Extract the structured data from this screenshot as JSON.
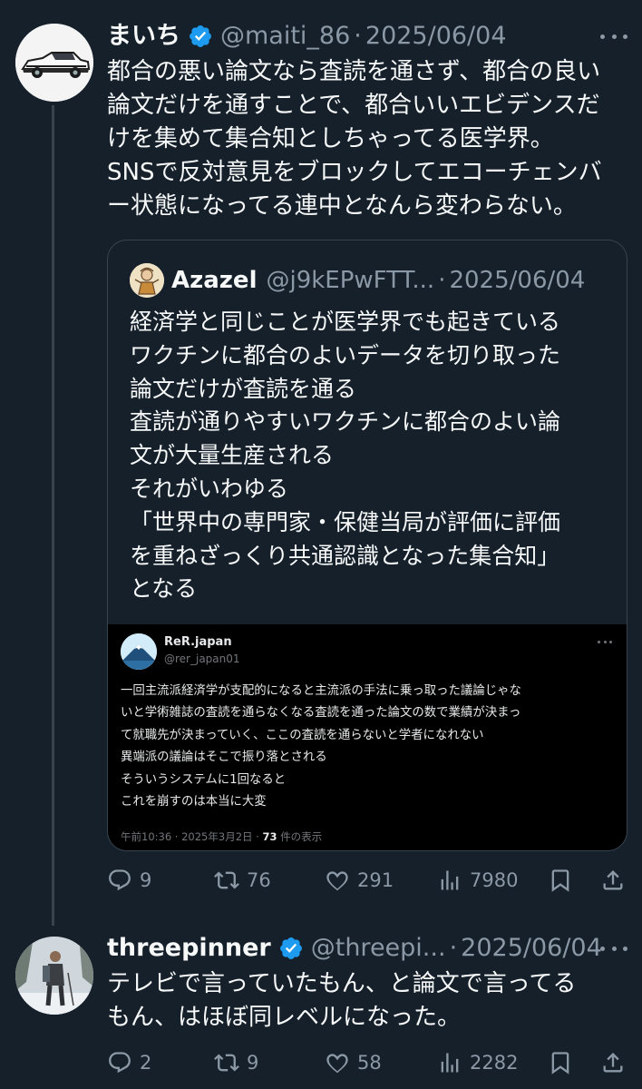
{
  "colors": {
    "background": "#15202b",
    "text": "#f7f9f9",
    "muted": "#8b98a5",
    "verified": "#1d9bf0",
    "border": "#38444d"
  },
  "tweets": [
    {
      "name": "まいち",
      "handle": "@maiti_86",
      "separator": "·",
      "date": "2025/06/04",
      "verified": true,
      "avatar_icon": "car-avatar",
      "text_lines": [
        "都合の悪い論文なら査読を通さず、都合の良い",
        "論文だけを通すことで、都合いいエビデンスだ",
        "けを集めて集合知としちゃってる医学界。",
        "SNSで反対意見をブロックしてエコーチェンバ",
        "ー状態になってる連中となんら変わらない。"
      ],
      "quote": {
        "name": "Azazel",
        "handle": "@j9kEPwFTT...",
        "separator": "·",
        "date": "2025/06/04",
        "text_lines": [
          "経済学と同じことが医学界でも起きている",
          "ワクチンに都合のよいデータを切り取った",
          "論文だけが査読を通る",
          "査読が通りやすいワクチンに都合のよい論",
          "文が大量生産される",
          "それがいわゆる",
          "「世界中の専門家・保健当局が評価に評価",
          "を重ねざっくり共通認識となった集合知」",
          "となる"
        ],
        "embedded": {
          "name": "ReR.japan",
          "handle": "@rer_japan01",
          "text_lines": [
            "一回主流派経済学が支配的になると主流派の手法に乗っ取った議論じゃな",
            "いと学術雑誌の査読を通らなくなる査読を通った論文の数で業績が決まっ",
            "て就職先が決まっていく、ここの査読を通らないと学者になれない",
            "異端派の議論はそこで振り落とされる",
            "そういうシステムに1回なると",
            "これを崩すのは本当に大変"
          ],
          "meta_prefix": "午前10:36 · 2025年3月2日 · ",
          "views": "73",
          "views_suffix": " 件の表示"
        }
      },
      "actions": {
        "replies": "9",
        "reposts": "76",
        "likes": "291",
        "views": "7980"
      }
    },
    {
      "name": "threepinner",
      "handle": "@threepi...",
      "separator": "·",
      "date": "2025/06/04",
      "verified": true,
      "avatar_icon": "hiker-avatar",
      "text_lines": [
        "テレビで言っていたもん、と論文で言ってる",
        "もん、はほぼ同レベルになった。"
      ],
      "actions": {
        "replies": "2",
        "reposts": "9",
        "likes": "58",
        "views": "2282"
      }
    }
  ]
}
